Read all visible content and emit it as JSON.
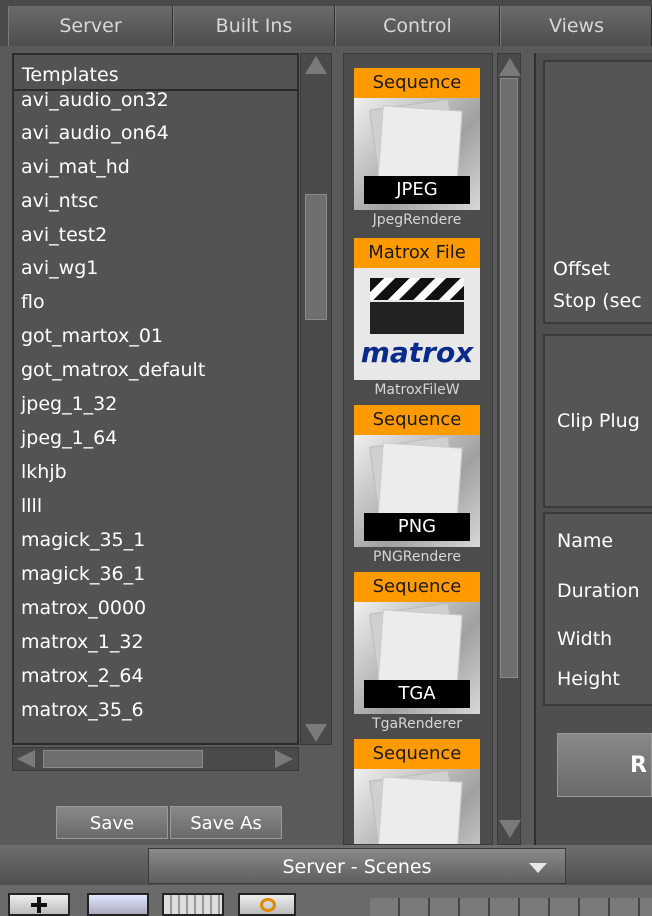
{
  "tabs": [
    "Server",
    "Built Ins",
    "Control",
    "Views"
  ],
  "templates": {
    "header": "Templates",
    "items": [
      "avi_audio_on32",
      "avi_audio_on64",
      "avi_mat_hd",
      "avi_ntsc",
      "avi_test2",
      "avi_wg1",
      "flo",
      "got_martox_01",
      "got_matrox_default",
      "jpeg_1_32",
      "jpeg_1_64",
      "lkhjb",
      "llll",
      "magick_35_1",
      "magick_36_1",
      "matrox_0000",
      "matrox_1_32",
      "matrox_2_64",
      "matrox_35_6"
    ]
  },
  "buttons": {
    "save": "Save",
    "save_as": "Save As"
  },
  "plugins": [
    {
      "label": "Sequence",
      "tag": "JPEG",
      "name": "JpegRendere"
    },
    {
      "label": "Matrox File",
      "tag": "matrox",
      "name": "MatroxFileW"
    },
    {
      "label": "Sequence",
      "tag": "PNG",
      "name": "PNGRendere"
    },
    {
      "label": "Sequence",
      "tag": "TGA",
      "name": "TgaRenderer"
    },
    {
      "label": "Sequence",
      "tag": "",
      "name": ""
    }
  ],
  "right_panel": {
    "offset": "Offset",
    "stop": "Stop (sec",
    "clip_plugin": "Clip Plug",
    "name": "Name",
    "duration": "Duration",
    "width": "Width",
    "height": "Height",
    "button_partial": "R"
  },
  "bottom": {
    "dropdown": "Server - Scenes"
  },
  "colors": {
    "accent": "#ff9a00"
  }
}
